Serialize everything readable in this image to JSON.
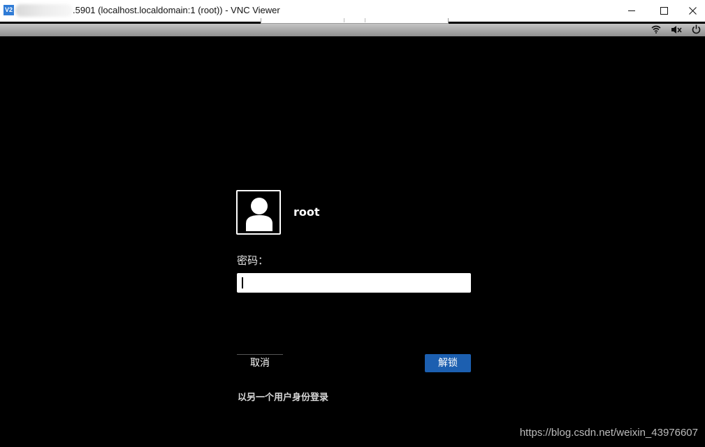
{
  "window": {
    "app_icon_text": "V2",
    "title": ".5901 (localhost.localdomain:1 (root)) - VNC Viewer",
    "minimize_symbol": "—",
    "maximize_symbol": "☐",
    "close_symbol": "✕"
  },
  "status_bar": {
    "icons": [
      "wifi-icon",
      "volume-muted-icon",
      "power-icon"
    ]
  },
  "lock_screen": {
    "avatar_icon": "user-avatar-icon",
    "username": "root",
    "password_label": "密码：",
    "password_value": "",
    "cancel_label": "取消",
    "unlock_label": "解锁",
    "login_as_other_user": "以另一个用户身份登录"
  },
  "watermark": "https://blog.csdn.net/weixin_43976607",
  "colors": {
    "background": "#000000",
    "unlock_button": "#1c5fb0",
    "top_bar": "#b0b0b0"
  }
}
